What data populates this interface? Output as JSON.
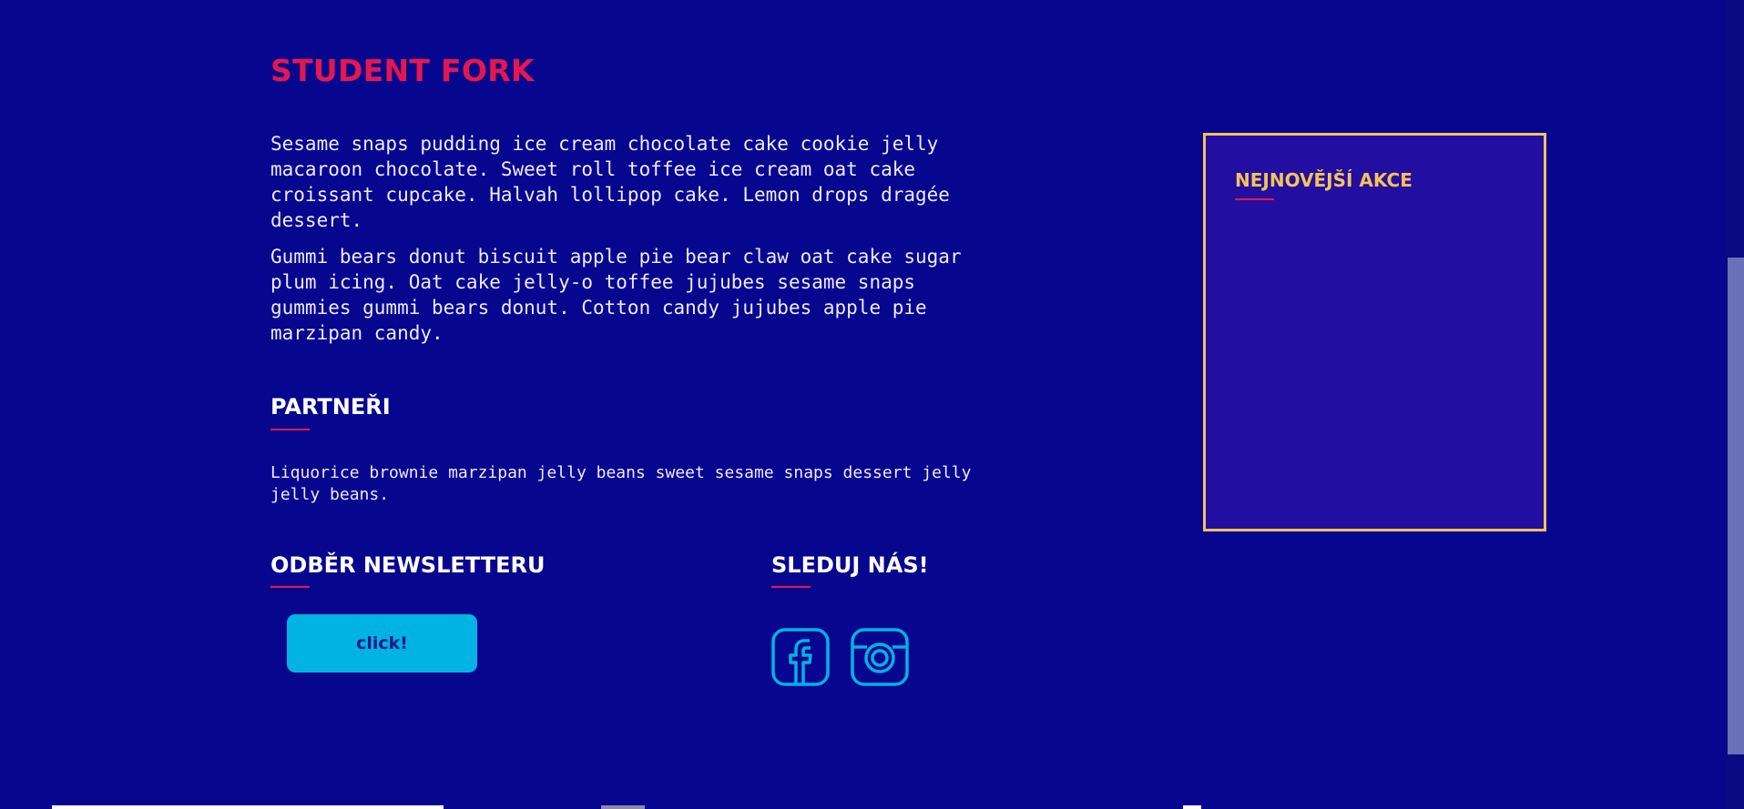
{
  "main": {
    "title": "STUDENT FORK",
    "paragraphs": [
      "Sesame snaps pudding ice cream chocolate cake cookie jelly macaroon chocolate. Sweet roll toffee ice cream oat cake croissant cupcake. Halvah lollipop cake. Lemon drops dragée dessert.",
      "Gummi bears donut biscuit apple pie bear claw oat cake sugar plum icing. Oat cake jelly-o toffee jujubes sesame snaps gummies gummi bears donut. Cotton candy jujubes apple pie marzipan candy."
    ]
  },
  "partners": {
    "heading": "PARTNEŘI",
    "text": "Liquorice brownie marzipan jelly beans sweet sesame snaps dessert jelly jelly beans."
  },
  "newsletter": {
    "heading": "ODBĚR NEWSLETTERU",
    "button_label": "click!"
  },
  "social": {
    "heading": "SLEDUJ NÁS!",
    "icons": [
      "facebook-icon",
      "instagram-icon"
    ]
  },
  "sidebar": {
    "title": "NEJNOVĚJŠÍ AKCE"
  },
  "colors": {
    "background": "#06068f",
    "accent_red": "#e4174f",
    "accent_cyan": "#00b3e3",
    "accent_yellow": "#f5c25a",
    "sidebar_bg": "#220ea0"
  }
}
